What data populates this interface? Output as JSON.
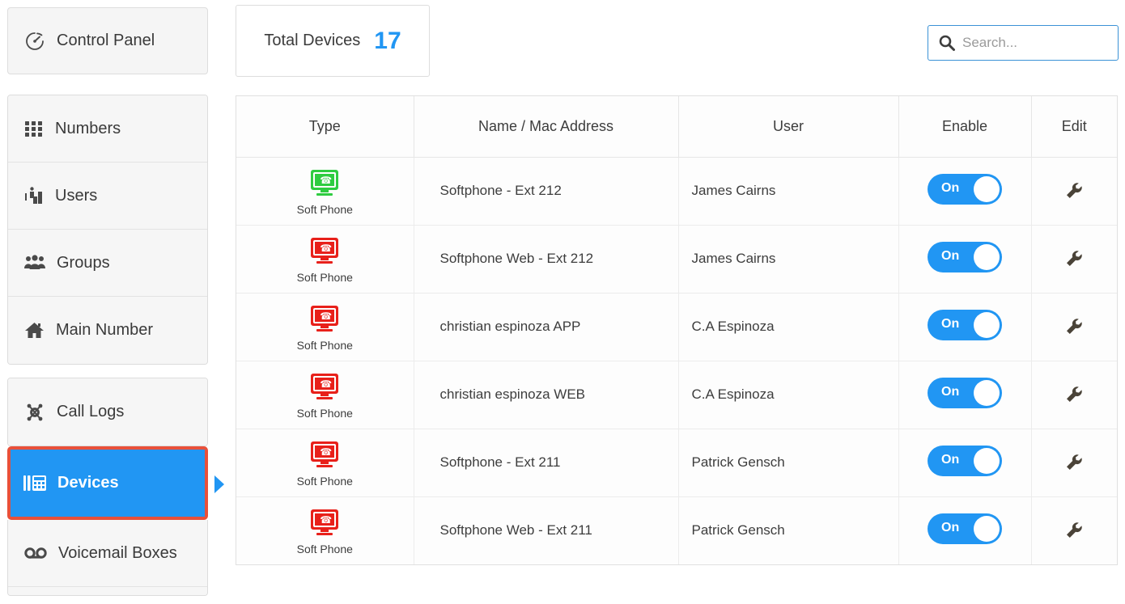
{
  "header": {
    "control_panel": {
      "label": "Control Panel",
      "icon": "dashboard-gauge-icon"
    },
    "total_devices": {
      "label": "Total Devices",
      "count": "17",
      "count_color": "#2196f3"
    },
    "search": {
      "placeholder": "Search...",
      "value": "",
      "icon": "search-icon",
      "border_color": "#3b92d6"
    }
  },
  "sidebar": {
    "groups": [
      {
        "items": [
          {
            "label": "Numbers",
            "icon": "grid-dots-icon",
            "active": false
          },
          {
            "label": "Users",
            "icon": "user-desk-icon",
            "active": false
          },
          {
            "label": "Groups",
            "icon": "users-group-icon",
            "active": false
          },
          {
            "label": "Main Number",
            "icon": "home-icon",
            "active": false
          }
        ]
      },
      {
        "items": [
          {
            "label": "Call Logs",
            "icon": "network-hub-icon",
            "active": false
          }
        ]
      }
    ],
    "active_item": {
      "label": "Devices",
      "icon": "desk-phone-icon",
      "active": true,
      "highlight_color": "#e8503a",
      "background": "#2196f3"
    },
    "after_active": [
      {
        "label": "Voicemail Boxes",
        "icon": "voicemail-icon",
        "active": false
      }
    ]
  },
  "table": {
    "columns": [
      "Type",
      "Name / Mac Address",
      "User",
      "Enable",
      "Edit"
    ],
    "rows": [
      {
        "type_icon": "softphone-monitor-icon",
        "type_color": "green",
        "type_label": "Soft Phone",
        "name": "Softphone - Ext 212",
        "user": "James Cairns",
        "enable": "On",
        "edit_icon": "wrench-icon"
      },
      {
        "type_icon": "softphone-monitor-icon",
        "type_color": "red",
        "type_label": "Soft Phone",
        "name": "Softphone Web - Ext 212",
        "user": "James Cairns",
        "enable": "On",
        "edit_icon": "wrench-icon"
      },
      {
        "type_icon": "softphone-monitor-icon",
        "type_color": "red",
        "type_label": "Soft Phone",
        "name": "christian espinoza APP",
        "user": "C.A Espinoza",
        "enable": "On",
        "edit_icon": "wrench-icon"
      },
      {
        "type_icon": "softphone-monitor-icon",
        "type_color": "red",
        "type_label": "Soft Phone",
        "name": "christian espinoza WEB",
        "user": "C.A Espinoza",
        "enable": "On",
        "edit_icon": "wrench-icon"
      },
      {
        "type_icon": "softphone-monitor-icon",
        "type_color": "red",
        "type_label": "Soft Phone",
        "name": "Softphone - Ext 211",
        "user": "Patrick Gensch",
        "enable": "On",
        "edit_icon": "wrench-icon"
      },
      {
        "type_icon": "softphone-monitor-icon",
        "type_color": "red",
        "type_label": "Soft Phone",
        "name": "Softphone Web - Ext 211",
        "user": "Patrick Gensch",
        "enable": "On",
        "edit_icon": "wrench-icon"
      }
    ]
  }
}
